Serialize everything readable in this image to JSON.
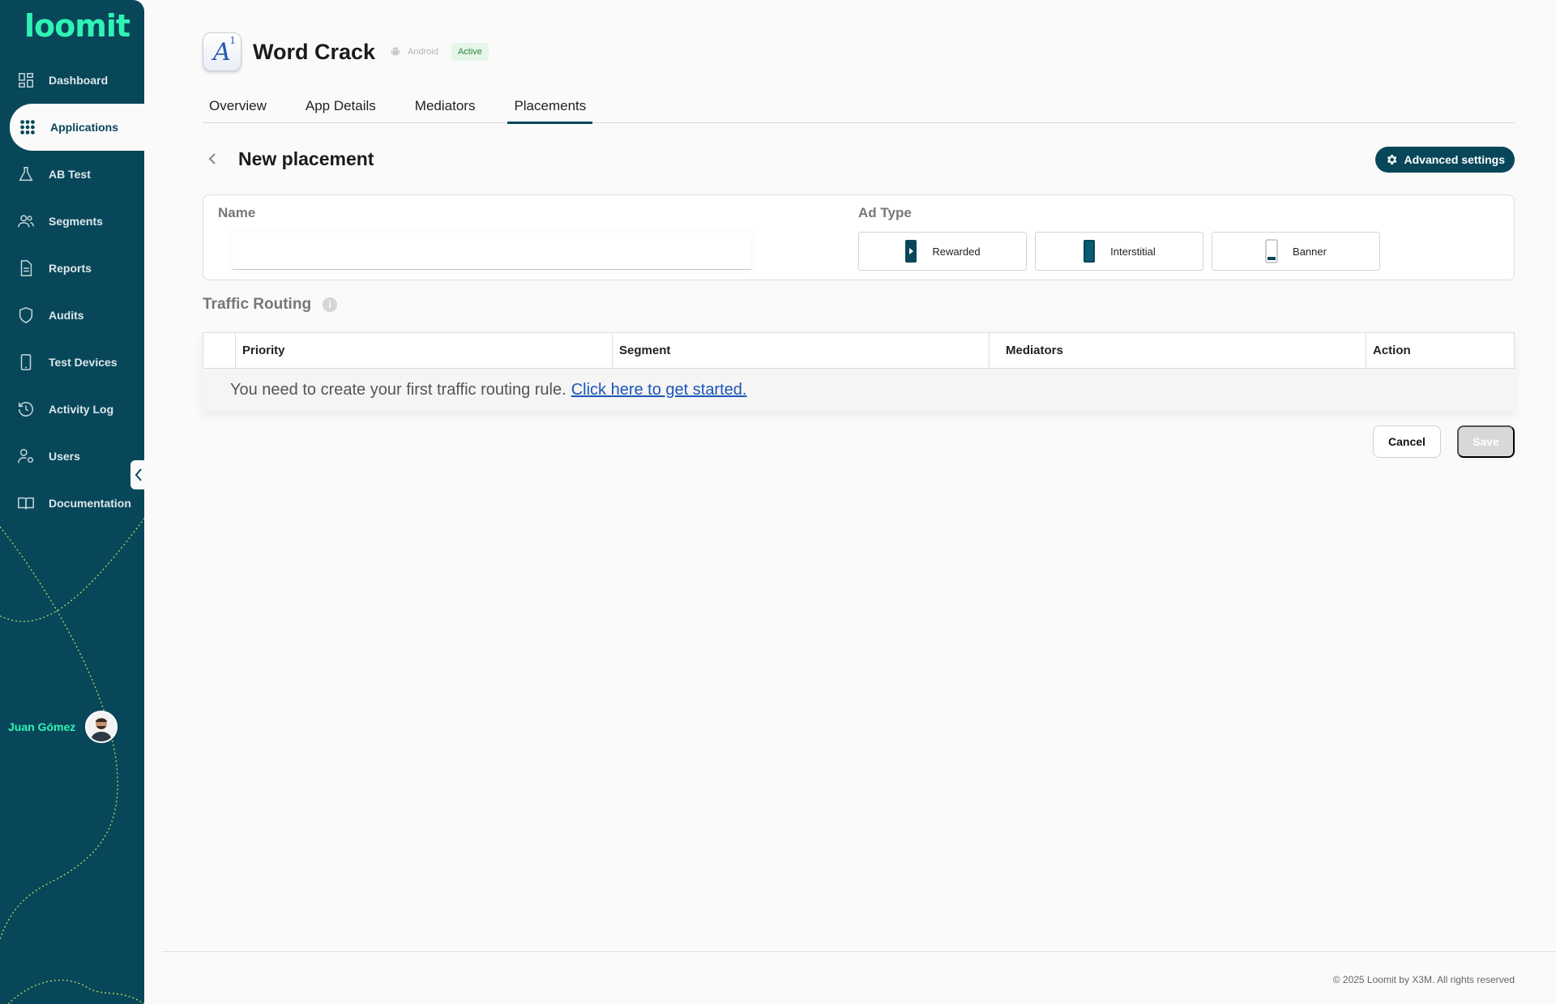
{
  "brand": {
    "logo_text": "loomit",
    "accent": "#2ff3b4",
    "sidebar_bg": "#08475a"
  },
  "sidebar": {
    "items": [
      {
        "label": "Dashboard",
        "icon": "dashboard-icon"
      },
      {
        "label": "Applications",
        "icon": "grid-icon",
        "active": true
      },
      {
        "label": "AB Test",
        "icon": "flask-icon"
      },
      {
        "label": "Segments",
        "icon": "users-icon"
      },
      {
        "label": "Reports",
        "icon": "document-icon"
      },
      {
        "label": "Audits",
        "icon": "shield-icon"
      },
      {
        "label": "Test Devices",
        "icon": "phone-icon"
      },
      {
        "label": "Activity Log",
        "icon": "history-icon"
      },
      {
        "label": "Users",
        "icon": "user-settings-icon"
      },
      {
        "label": "Documentation",
        "icon": "book-icon"
      }
    ],
    "user_name": "Juan Gómez"
  },
  "app": {
    "name": "Word Crack",
    "platform": "Android",
    "status": "Active"
  },
  "tabs": [
    "Overview",
    "App Details",
    "Mediators",
    "Placements"
  ],
  "active_tab": "Placements",
  "placement": {
    "title": "New placement",
    "advanced_settings_label": "Advanced settings",
    "name_label": "Name",
    "name_value": "",
    "ad_type_label": "Ad Type",
    "ad_types": [
      "Rewarded",
      "Interstitial",
      "Banner"
    ]
  },
  "traffic_routing": {
    "title": "Traffic Routing",
    "info_glyph": "i",
    "columns": [
      "",
      "Priority",
      "Segment",
      "Mediators",
      "Action"
    ],
    "empty_message": "You need to create your first traffic routing rule.",
    "empty_link": "Click here to get started."
  },
  "actions": {
    "cancel_label": "Cancel",
    "save_label": "Save"
  },
  "footer": {
    "copyright": "© 2025 Loomit by X3M. All rights reserved"
  }
}
